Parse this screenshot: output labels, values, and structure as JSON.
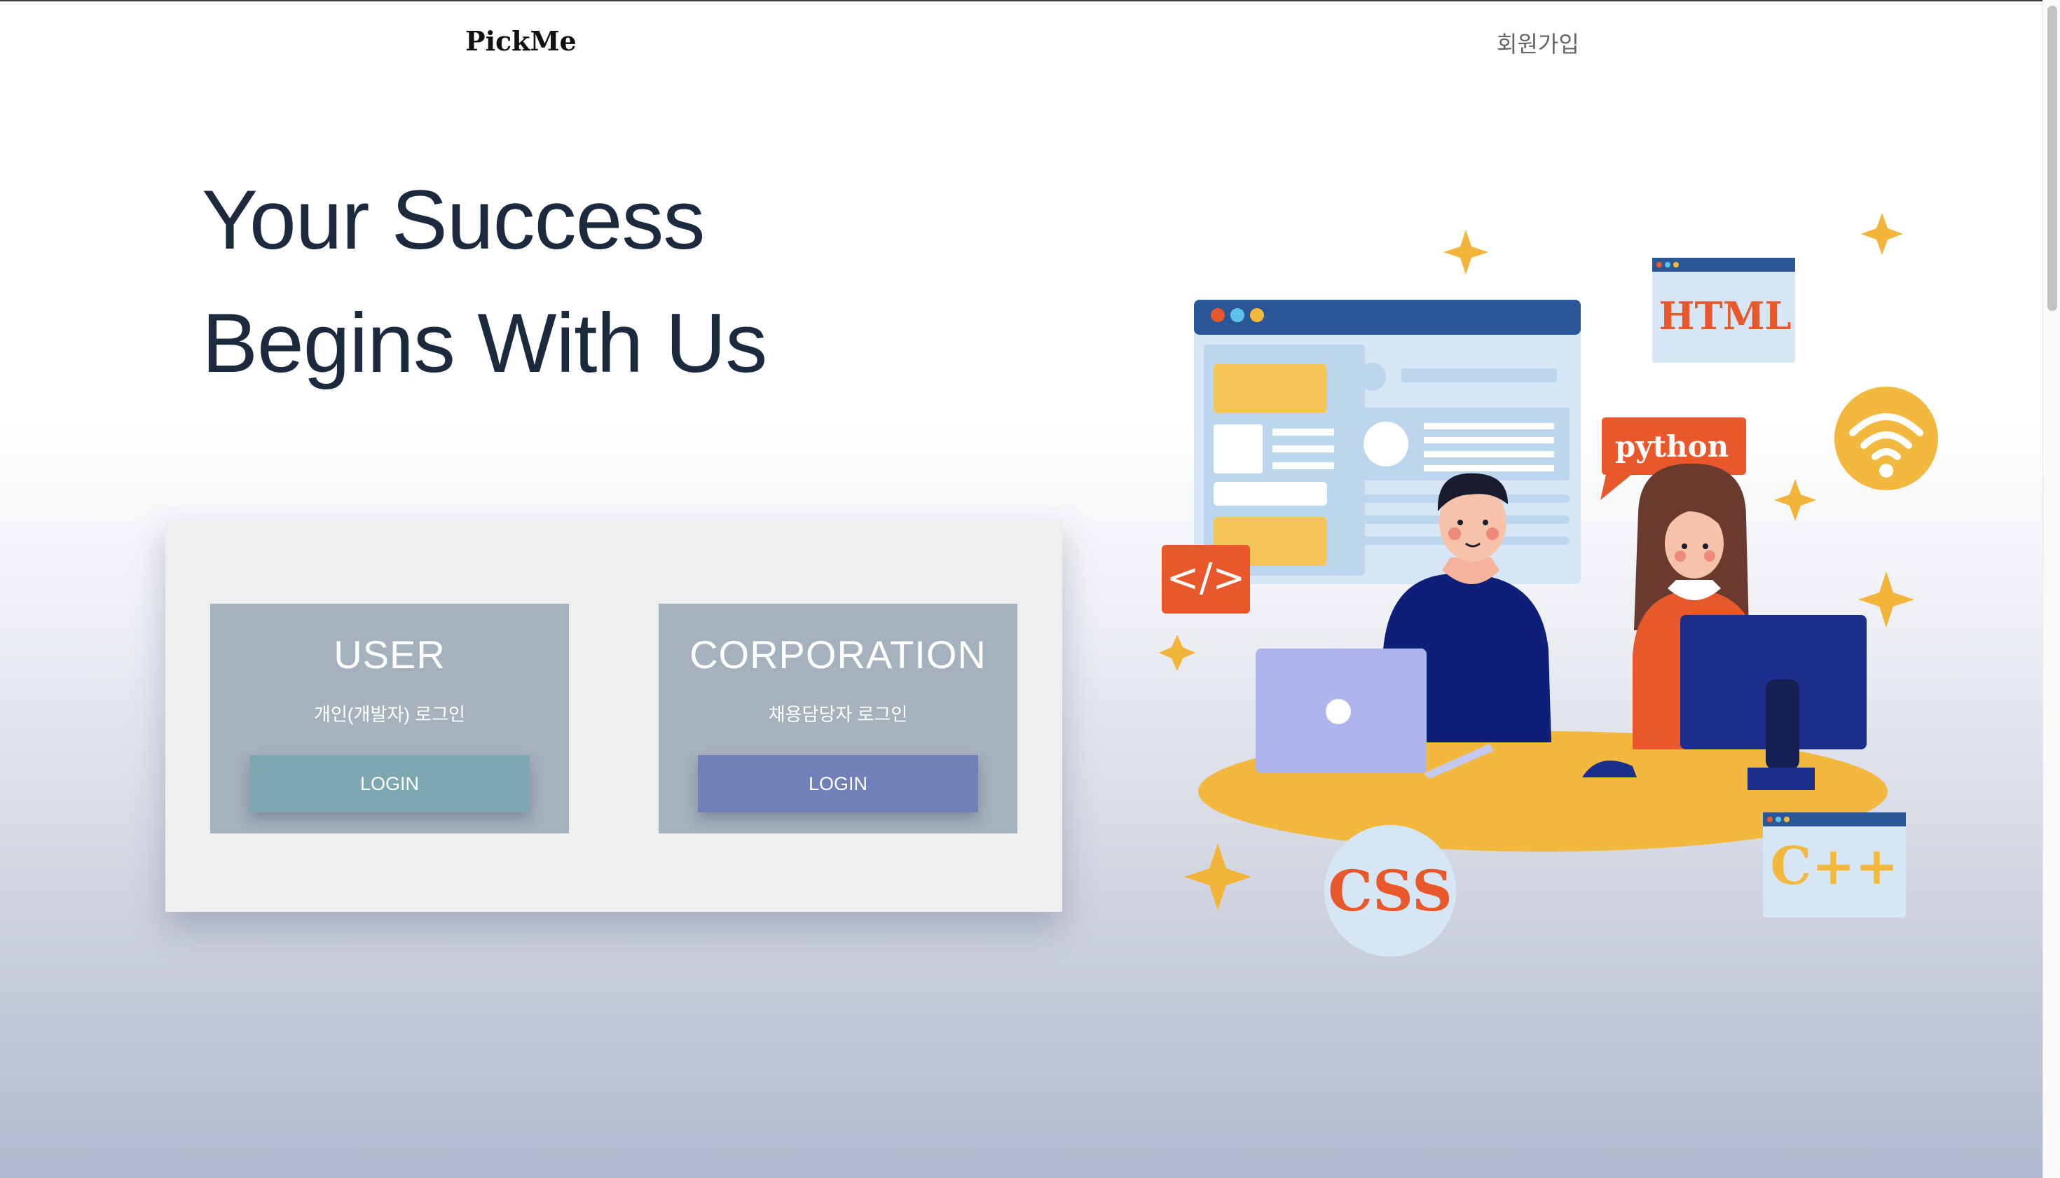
{
  "header": {
    "logo": "PickMe",
    "signup_link": "회원가입"
  },
  "hero": {
    "line1": "Your Success",
    "line2": "Begins With Us"
  },
  "login": {
    "user": {
      "title": "USER",
      "subtitle": "개인(개발자) 로그인",
      "button": "LOGIN",
      "button_color": "#7da8b1"
    },
    "corporation": {
      "title": "CORPORATION",
      "subtitle": "채용담당자 로그인",
      "button": "LOGIN",
      "button_color": "#7180b8"
    }
  },
  "illustration": {
    "badges": {
      "html": "HTML",
      "python": "python",
      "css": "CSS",
      "cpp": "C++",
      "code": "</>"
    },
    "icons": [
      "code-icon",
      "wifi-icon",
      "sparkle-icon",
      "laptop-icon",
      "monitor-icon",
      "mouse-icon",
      "browser-window-icon"
    ],
    "colors": {
      "accent_orange": "#e8582a",
      "accent_yellow": "#f3b93f",
      "window_blue": "#2a5796",
      "navy": "#0d1f78"
    }
  }
}
